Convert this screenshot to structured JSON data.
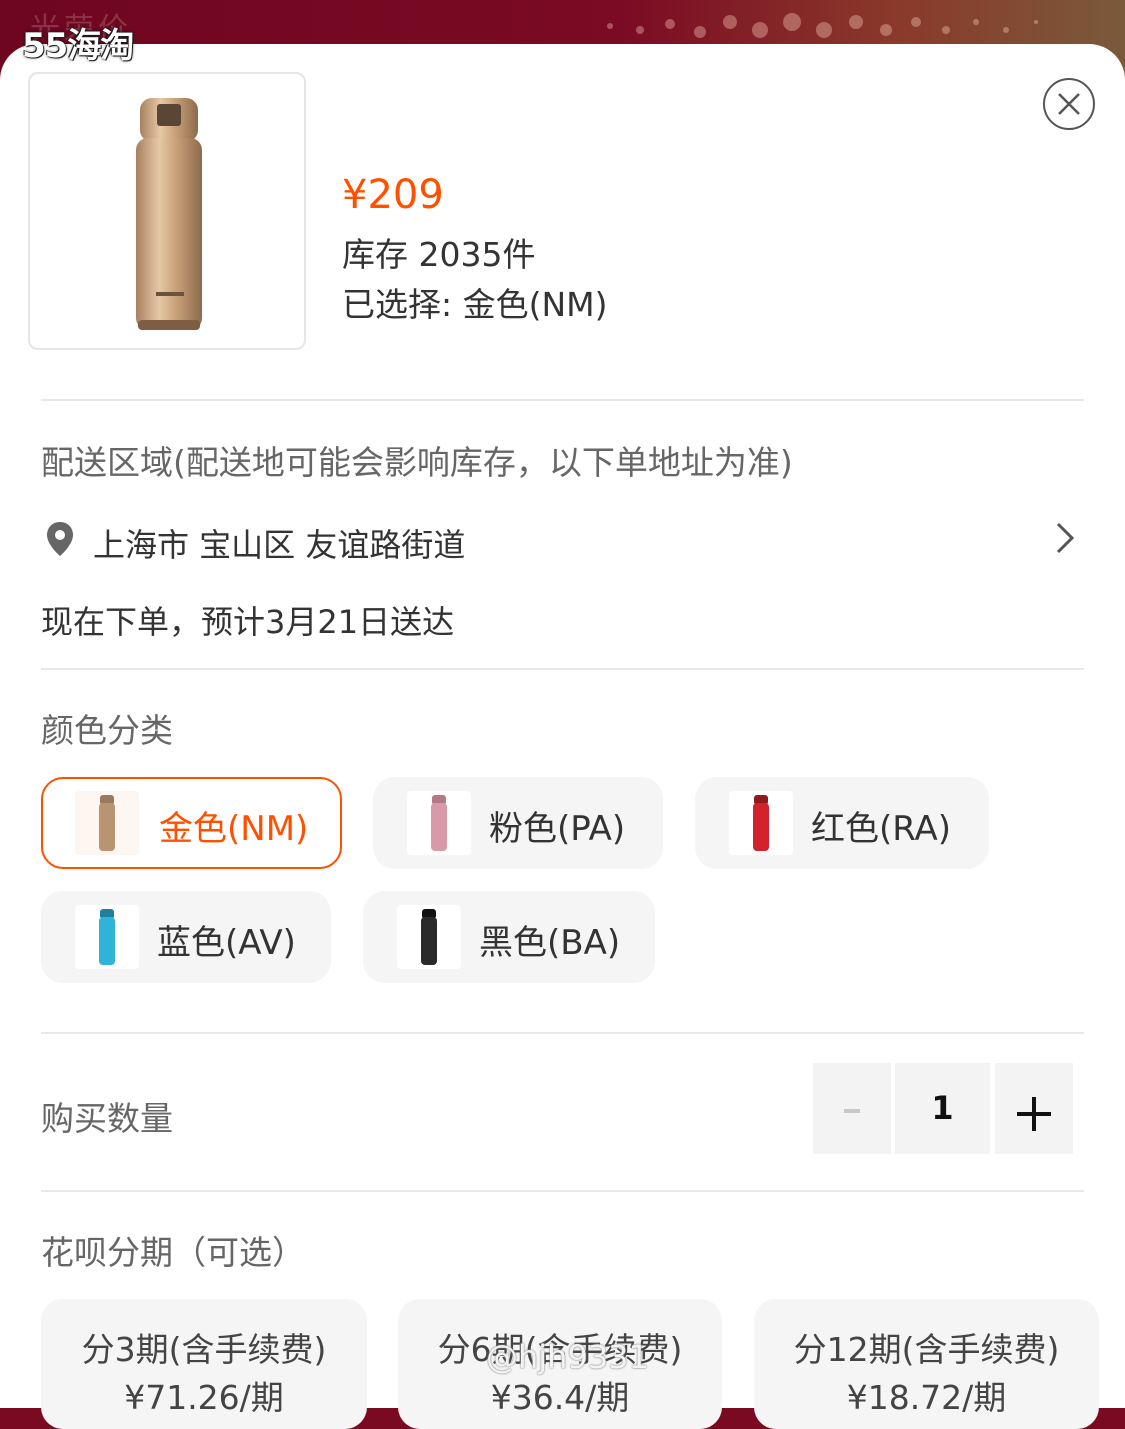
{
  "header": {
    "ghost_text": "光荣价",
    "logo": "55海淘"
  },
  "product": {
    "price": "¥209",
    "stock": "库存 2035件",
    "selected": "已选择: 金色(NM)",
    "image_color": "#c9a27a"
  },
  "delivery": {
    "section_title": "配送区域(配送地可能会影响库存，以下单地址为准)",
    "address": "上海市 宝山区 友谊路街道",
    "estimate": "现在下单，预计3月21日送达"
  },
  "colors": {
    "section_title": "颜色分类",
    "options": [
      {
        "label": "金色(NM)",
        "swatch": "#b89472",
        "selected": true
      },
      {
        "label": "粉色(PA)",
        "swatch": "#d79aa6",
        "selected": false
      },
      {
        "label": "红色(RA)",
        "swatch": "#d4222c",
        "selected": false
      },
      {
        "label": "蓝色(AV)",
        "swatch": "#2fb3d8",
        "selected": false
      },
      {
        "label": "黑色(BA)",
        "swatch": "#2a2a2a",
        "selected": false
      }
    ]
  },
  "quantity": {
    "label": "购买数量",
    "minus": "-",
    "value": "1",
    "plus": "+"
  },
  "installments": {
    "section_title": "花呗分期（可选）",
    "options": [
      {
        "title": "分3期(含手续费)",
        "amount": "¥71.26/期"
      },
      {
        "title": "分6期(含手续费)",
        "amount": "¥36.4/期"
      },
      {
        "title": "分12期(含手续费)",
        "amount": "¥18.72/期"
      }
    ]
  },
  "watermark": "@hjh9331",
  "accent_color": "#ff5000"
}
